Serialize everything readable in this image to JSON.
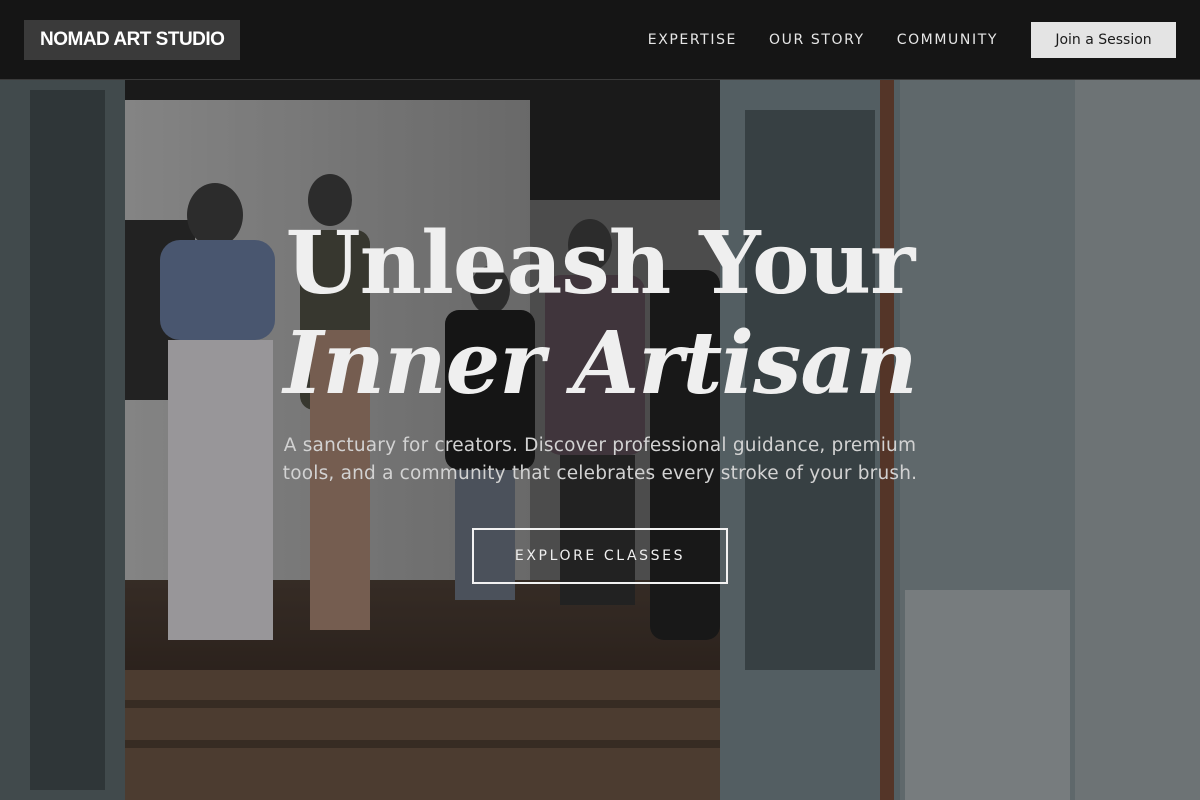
{
  "header": {
    "logo": "NOMAD ART STUDIO",
    "nav": [
      {
        "label": "EXPERTISE"
      },
      {
        "label": "OUR STORY"
      },
      {
        "label": "COMMUNITY"
      }
    ],
    "cta_label": "Join a Session"
  },
  "hero": {
    "headline_line1": "Unleash Your",
    "headline_line2": "Inner Artisan",
    "subtitle": "A sanctuary for creators. Discover professional guidance, premium tools, and a community that celebrates every stroke of your brush.",
    "button_label": "EXPLORE CLASSES"
  },
  "colors": {
    "nav_background": "#161616",
    "logo_background": "#3a3a3a",
    "cta_background": "#e4e4e4",
    "headline": "#efefef"
  }
}
